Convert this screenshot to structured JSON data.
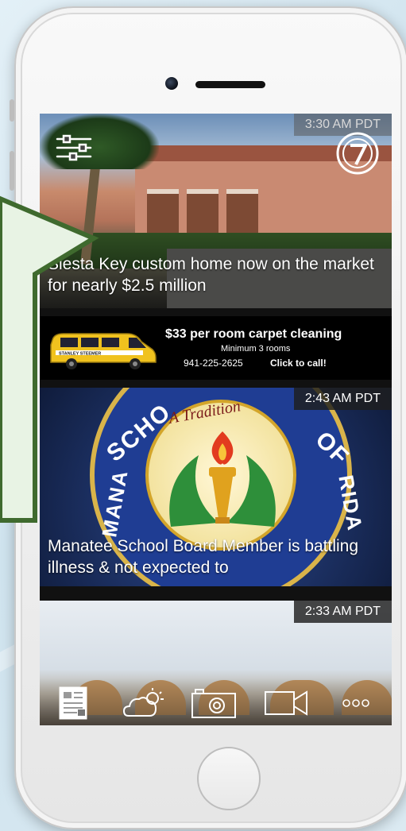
{
  "stories": [
    {
      "timestamp": "3:30 AM PDT",
      "headline": "Siesta Key custom home now on the market for nearly $2.5 million"
    },
    {
      "timestamp": "2:43 AM PDT",
      "headline": "Manatee School Board Member is battling illness & not expected to",
      "seal_top_text": "A Tradition"
    },
    {
      "timestamp": "2:33 AM PDT"
    }
  ],
  "ad": {
    "headline": "$33 per room carpet cleaning",
    "subline": "Minimum 3 rooms",
    "phone": "941-225-2625",
    "cta": "Click to call!",
    "vehicle_brand": "STANLEY STEEMER"
  },
  "tabbar": [
    {
      "icon": "news-icon",
      "active": true
    },
    {
      "icon": "weather-icon",
      "active": false
    },
    {
      "icon": "camera-icon",
      "active": false
    },
    {
      "icon": "video-icon",
      "active": false
    },
    {
      "icon": "more-icon",
      "active": false
    }
  ],
  "colors": {
    "callout_fill": "#e8f3e4",
    "callout_border": "#3f6a2e",
    "seal_blue": "#1f3d93",
    "seal_gold": "#d9b44a"
  }
}
